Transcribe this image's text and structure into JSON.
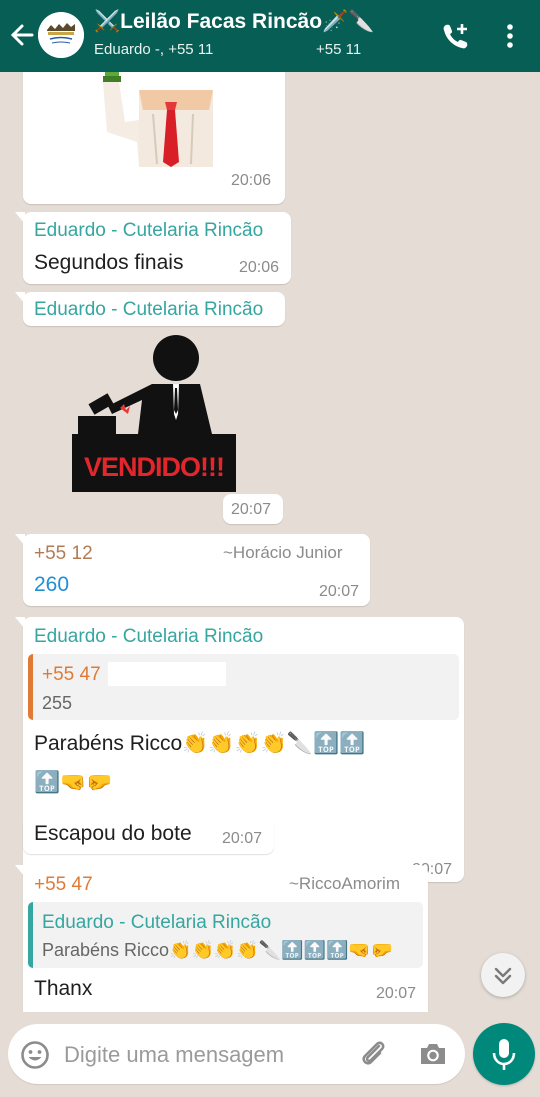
{
  "header": {
    "title": "⚔️Leilão Facas Rincão🗡️🔪",
    "subtitle": "Eduardo -, +55 11",
    "subtitle2": "+55 11"
  },
  "messages": {
    "m1": {
      "time": "20:06"
    },
    "m2": {
      "sender": "Eduardo - Cutelaria Rincão",
      "text": "Segundos finais",
      "time": "20:06"
    },
    "m3": {
      "sender": "Eduardo - Cutelaria Rincão",
      "sticker_text": "VENDIDO!!!",
      "time": "20:07"
    },
    "m4": {
      "sender": "+55 12",
      "pushname": "~Horácio Junior",
      "text": "260",
      "time": "20:07"
    },
    "m5": {
      "sender": "Eduardo - Cutelaria Rincão",
      "quote_sender": "+55 47",
      "quote_text": "255",
      "text": "Parabéns Ricco👏👏👏👏🔪🔝🔝",
      "text2": "🔝🤜🤛",
      "time": "20:07"
    },
    "m6": {
      "text": "Escapou do bote",
      "time": "20:07"
    },
    "m7": {
      "sender": "+55 47",
      "pushname": "~RiccoAmorim",
      "quote_sender": "Eduardo - Cutelaria Rincão",
      "quote_text": "Parabéns Ricco👏👏👏👏🔪🔝🔝🔝🤜🤛",
      "text": "Thanx",
      "time": "20:07"
    }
  },
  "input": {
    "placeholder": "Digite uma mensagem"
  },
  "colors": {
    "header": "#075e54",
    "chat_bg": "#e5ddd5",
    "mic": "#00897b",
    "teal_sender": "#35a6a0",
    "orange_sender": "#e07a35"
  },
  "icons": [
    "back-arrow-icon",
    "add-call-icon",
    "more-options-icon",
    "emoji-icon",
    "attach-icon",
    "camera-icon",
    "mic-icon",
    "scroll-down-icon"
  ]
}
